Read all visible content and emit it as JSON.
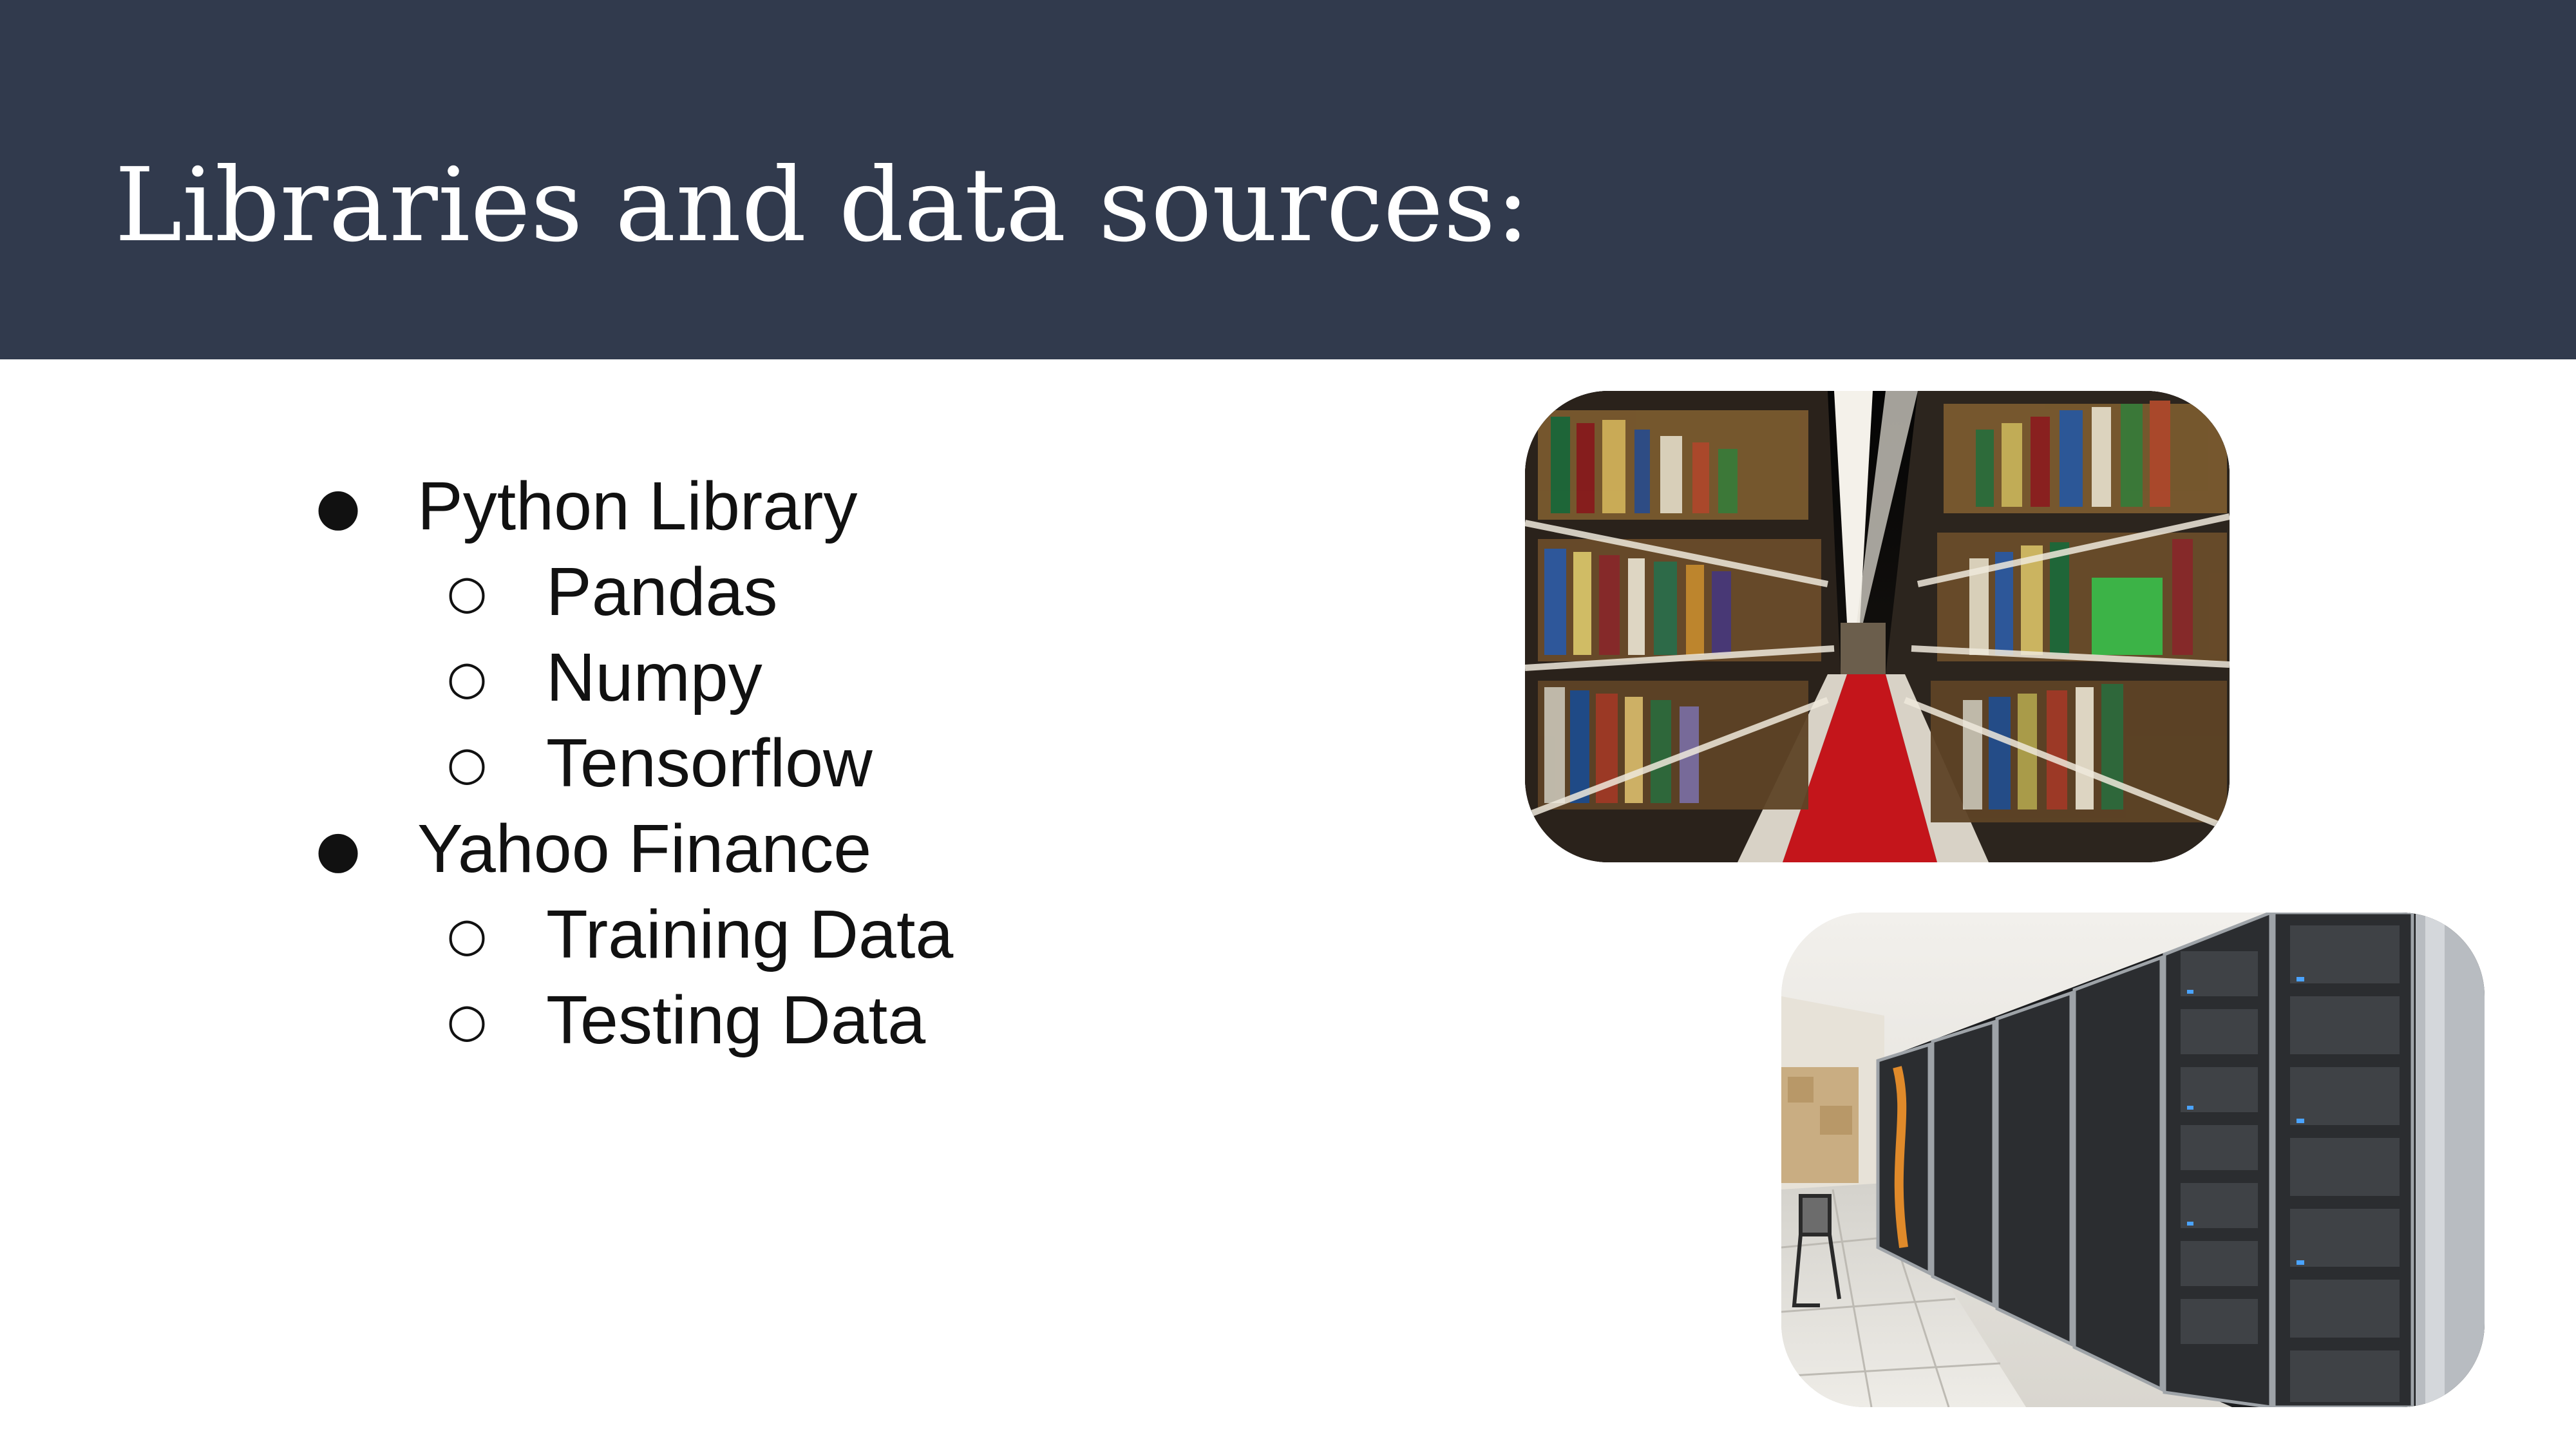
{
  "slide": {
    "title": "Libraries and data sources:",
    "colors": {
      "title_bar": "#313a4d",
      "title_text": "#ffffff",
      "body_text": "#111111",
      "background": "#ffffff"
    },
    "bullets": [
      {
        "level": 1,
        "marker": "●",
        "text": "Python Library"
      },
      {
        "level": 2,
        "marker": "○",
        "text": "Pandas"
      },
      {
        "level": 2,
        "marker": "○",
        "text": "Numpy"
      },
      {
        "level": 2,
        "marker": "○",
        "text": "Tensorflow"
      },
      {
        "level": 1,
        "marker": "●",
        "text": "Yahoo Finance"
      },
      {
        "level": 2,
        "marker": "○",
        "text": "Training Data"
      },
      {
        "level": 2,
        "marker": "○",
        "text": "Testing Data"
      }
    ],
    "images": [
      {
        "name": "library-bookshelves-photo",
        "subject": "library aisle with bookshelves and red carpet"
      },
      {
        "name": "server-room-photo",
        "subject": "row of server racks in a data center"
      }
    ]
  }
}
